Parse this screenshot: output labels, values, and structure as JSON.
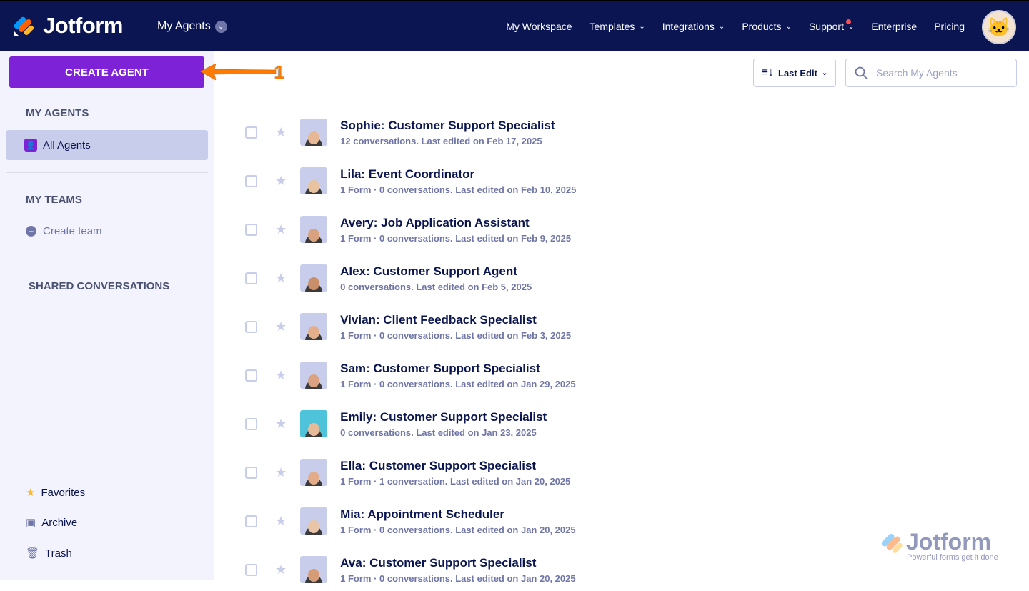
{
  "header": {
    "brand": "Jotform",
    "section": "My Agents",
    "nav": [
      {
        "label": "My Workspace",
        "dropdown": false
      },
      {
        "label": "Templates",
        "dropdown": true
      },
      {
        "label": "Integrations",
        "dropdown": true
      },
      {
        "label": "Products",
        "dropdown": true
      },
      {
        "label": "Support",
        "dropdown": true,
        "notification": true
      },
      {
        "label": "Enterprise",
        "dropdown": false
      },
      {
        "label": "Pricing",
        "dropdown": false
      }
    ]
  },
  "sidebar": {
    "create_label": "CREATE AGENT",
    "my_agents": "MY AGENTS",
    "all_agents": "All Agents",
    "my_teams": "MY TEAMS",
    "create_team": "Create team",
    "shared": "SHARED CONVERSATIONS",
    "favorites": "Favorites",
    "archive": "Archive",
    "trash": "Trash"
  },
  "annotation": "1",
  "toolbar": {
    "sort_label": "Last Edit",
    "search_placeholder": "Search My Agents"
  },
  "agents": [
    {
      "name": "Sophie: Customer Support Specialist",
      "meta": "12 conversations. Last edited on Feb 17, 2025"
    },
    {
      "name": "Lila: Event Coordinator",
      "meta": "1 Form · 0 conversations. Last edited on Feb 10, 2025"
    },
    {
      "name": "Avery: Job Application Assistant",
      "meta": "1 Form · 0 conversations. Last edited on Feb 9, 2025"
    },
    {
      "name": "Alex: Customer Support Agent",
      "meta": "0 conversations. Last edited on Feb 5, 2025"
    },
    {
      "name": "Vivian: Client Feedback Specialist",
      "meta": "1 Form · 0 conversations. Last edited on Feb 3, 2025"
    },
    {
      "name": "Sam: Customer Support Specialist",
      "meta": "1 Form · 0 conversations. Last edited on Jan 29, 2025"
    },
    {
      "name": "Emily: Customer Support Specialist",
      "meta": "0 conversations. Last edited on Jan 23, 2025"
    },
    {
      "name": "Ella: Customer Support Specialist",
      "meta": "1 Form · 1 conversation. Last edited on Jan 20, 2025"
    },
    {
      "name": "Mia: Appointment Scheduler",
      "meta": "1 Form · 0 conversations. Last edited on Jan 20, 2025"
    },
    {
      "name": "Ava: Customer Support Specialist",
      "meta": "1 Form · 0 conversations. Last edited on Jan 20, 2025"
    }
  ],
  "watermark": {
    "brand": "Jotform",
    "tagline": "Powerful forms get it done"
  }
}
